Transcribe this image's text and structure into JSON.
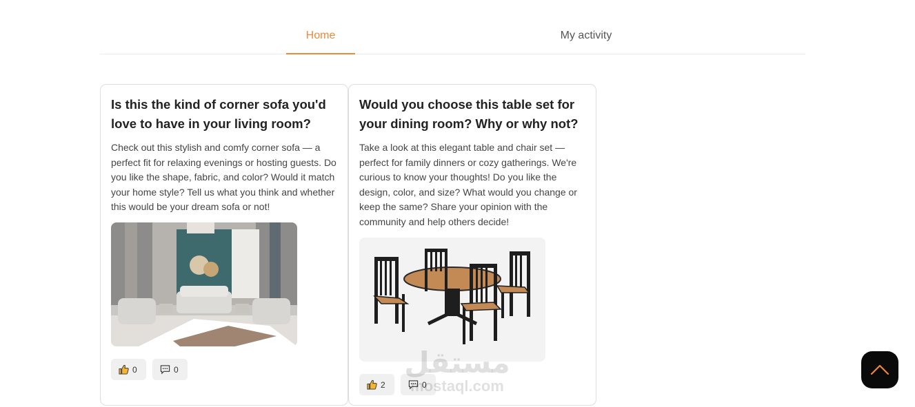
{
  "nav": {
    "tabs": [
      {
        "label": "Home",
        "active": true
      },
      {
        "label": "My activity",
        "active": false
      }
    ]
  },
  "posts": [
    {
      "title": "Is this the kind of corner sofa you'd love to have in your living room?",
      "body": "Check out this stylish and comfy corner sofa — a perfect fit for relaxing evenings or hosting guests. Do you like the shape, fabric, and color? Would it match your home style? Tell us what you think and whether this would be your dream sofa or not!",
      "image": "living-room-sofa-photo",
      "likes": "0",
      "comments": "0"
    },
    {
      "title": "Would you choose this table set for your dining room? Why or why not?",
      "body": "Take a look at this elegant table and chair set — perfect for family dinners or cozy gatherings. We're curious to know your thoughts! Do you like the design, color, and size? What would you change or keep the same? Share your opinion with the community and help others decide!",
      "image": "dining-table-set-photo",
      "likes": "2",
      "comments": "0"
    }
  ],
  "watermark": {
    "arabic": "مستقل",
    "latin": "mostaql.com"
  },
  "colors": {
    "accent": "#f0883a",
    "scroll_button": "#0a0a0a"
  },
  "icons": {
    "like": "thumbs-up-icon",
    "comment": "comment-icon",
    "scroll_top": "chevron-up-icon"
  }
}
